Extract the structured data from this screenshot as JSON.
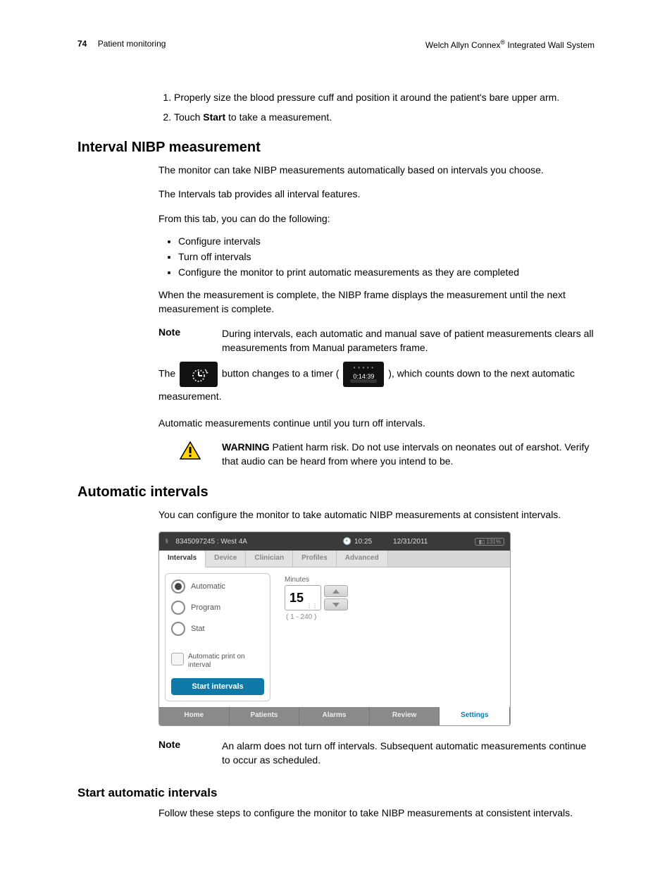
{
  "header": {
    "page_number": "74",
    "section": "Patient monitoring",
    "product_prefix": "Welch Allyn Connex",
    "product_suffix": " Integrated Wall System",
    "reg": "®"
  },
  "steps": {
    "s1_pre": "Properly size the blood pressure cuff and position it around the patient's bare upper arm.",
    "s2_pre": "Touch ",
    "s2_bold": "Start",
    "s2_post": " to take a measurement."
  },
  "h_interval": "Interval NIBP measurement",
  "interval": {
    "p1": "The monitor can take NIBP measurements automatically based on intervals you choose.",
    "p2": "The Intervals tab provides all interval features.",
    "p3": "From this tab, you can do the following:",
    "b1": "Configure intervals",
    "b2": "Turn off intervals",
    "b3": "Configure the monitor to print automatic measurements as they are completed",
    "p4": "When the measurement is complete, the NIBP frame displays the measurement until the next measurement is complete.",
    "note_label": "Note",
    "note_text": "During intervals, each automatic and manual save of patient measurements clears all measurements from Manual parameters frame.",
    "inline_pre": "The ",
    "inline_mid": "button changes to a timer ( ",
    "inline_post": "), which counts down to the next automatic measurement.",
    "timer_value": "0:14:39",
    "p5": "Automatic measurements continue until you turn off intervals.",
    "warn_bold": "WARNING",
    "warn_text": "   Patient harm risk. Do not use intervals on neonates out of earshot. Verify that audio can be heard from where you intend to be."
  },
  "h_auto": "Automatic intervals",
  "auto": {
    "p1": "You can configure the monitor to take automatic NIBP measurements at consistent intervals.",
    "note_label": "Note",
    "note_text": "An alarm does not turn off intervals. Subsequent automatic measurements continue to occur as scheduled."
  },
  "h_start": "Start automatic intervals",
  "start": {
    "p1": "Follow these steps to configure the monitor to take NIBP measurements at consistent intervals."
  },
  "monitor": {
    "patient": "8345097245 : West 4A",
    "time": "10:25",
    "date": "12/31/2011",
    "battery": "131%",
    "tabs": [
      "Intervals",
      "Device",
      "Clinician",
      "Profiles",
      "Advanced"
    ],
    "radios": [
      "Automatic",
      "Program",
      "Stat"
    ],
    "checkbox": "Automatic print on interval",
    "start_btn": "Start intervals",
    "minutes_label": "Minutes",
    "minutes_value": "15",
    "range": "( 1 - 240 )",
    "nav": [
      "Home",
      "Patients",
      "Alarms",
      "Review",
      "Settings"
    ]
  }
}
